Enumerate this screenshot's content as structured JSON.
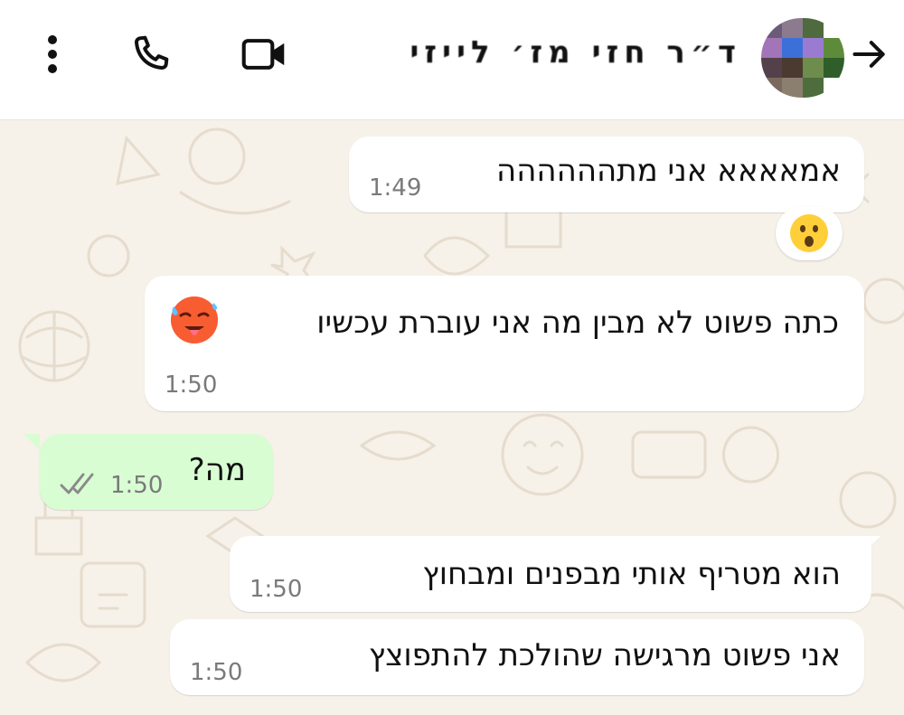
{
  "header": {
    "contact_name": "ד״ר חזי מז׳ לייזי",
    "back_icon": "arrow-right-icon",
    "video_icon": "video-camera-icon",
    "call_icon": "phone-icon",
    "menu_icon": "more-vertical-icon"
  },
  "messages": [
    {
      "direction": "incoming",
      "text": "אמאאאא אני מתהההההה",
      "time": "1:49"
    },
    {
      "direction": "incoming",
      "text": "כתה פשוט לא מבין מה אני עוברת עכשיו",
      "time": "1:50"
    },
    {
      "direction": "outgoing",
      "text": "מה?",
      "time": "1:50",
      "status": "read"
    },
    {
      "direction": "incoming",
      "text": "הוא מטריף אותי מבפנים ומבחוץ",
      "time": "1:50"
    },
    {
      "direction": "incoming",
      "text": "אני פשוט מרגישה שהולכת להתפוצץ",
      "time": "1:50"
    }
  ],
  "reaction": {
    "emoji": "surprised-face-icon"
  },
  "colors": {
    "outgoing_bubble": "#d9fdd3",
    "incoming_bubble": "#ffffff",
    "wallpaper": "#f6f1e9",
    "tick_color": "#8a8a8a"
  }
}
